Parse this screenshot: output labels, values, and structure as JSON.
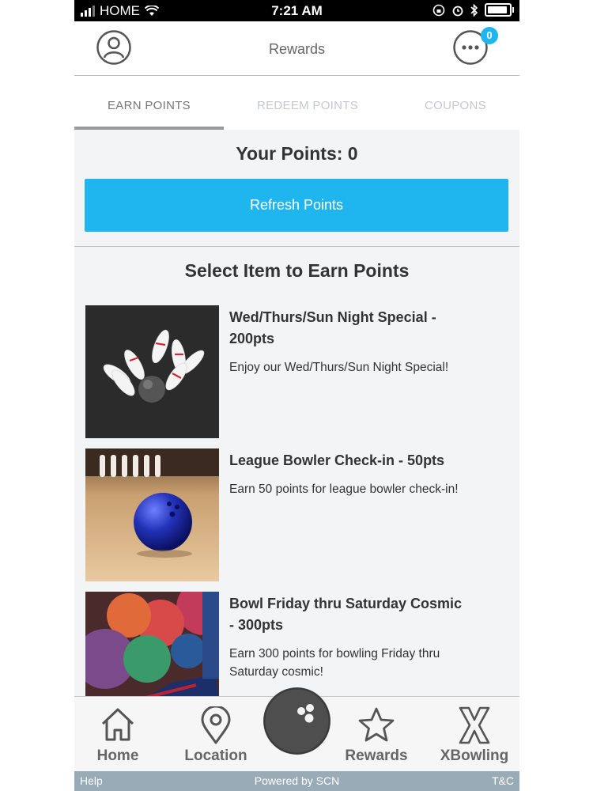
{
  "status_bar": {
    "carrier": "HOME",
    "time": "7:21 AM"
  },
  "header": {
    "title": "Rewards",
    "badge_count": "0"
  },
  "tabs": [
    {
      "label": "EARN POINTS",
      "active": true
    },
    {
      "label": "REDEEM POINTS",
      "active": false
    },
    {
      "label": "COUPONS",
      "active": false
    }
  ],
  "points": {
    "label": "Your Points: 0",
    "refresh_label": "Refresh Points"
  },
  "section_title": "Select Item to Earn Points",
  "items": [
    {
      "title": "Wed/Thurs/Sun Night Special - 200pts",
      "description": "Enjoy our Wed/Thurs/Sun Night Special!",
      "image": "bowling-pins-strike"
    },
    {
      "title": "League Bowler Check-in - 50pts",
      "description": "Earn 50 points for league bowler check-in!",
      "image": "blue-bowling-ball"
    },
    {
      "title": "Bowl Friday thru Saturday Cosmic - 300pts",
      "description": "Earn 300 points for bowling Friday thru Saturday cosmic!",
      "image": "colorful-bowling-balls"
    }
  ],
  "bottom_nav": [
    {
      "label": "Home",
      "icon": "home-icon"
    },
    {
      "label": "Location",
      "icon": "location-pin-icon"
    },
    {
      "label": "",
      "icon": "bowling-ball-icon"
    },
    {
      "label": "Rewards",
      "icon": "star-icon"
    },
    {
      "label": "XBowling",
      "icon": "x-icon"
    }
  ],
  "footer": {
    "help": "Help",
    "powered_by": "Powered by SCN",
    "tc": "T&C"
  },
  "colors": {
    "accent": "#1fb6f0",
    "nav_text": "#666666",
    "footer_bg": "#9aabb8"
  }
}
